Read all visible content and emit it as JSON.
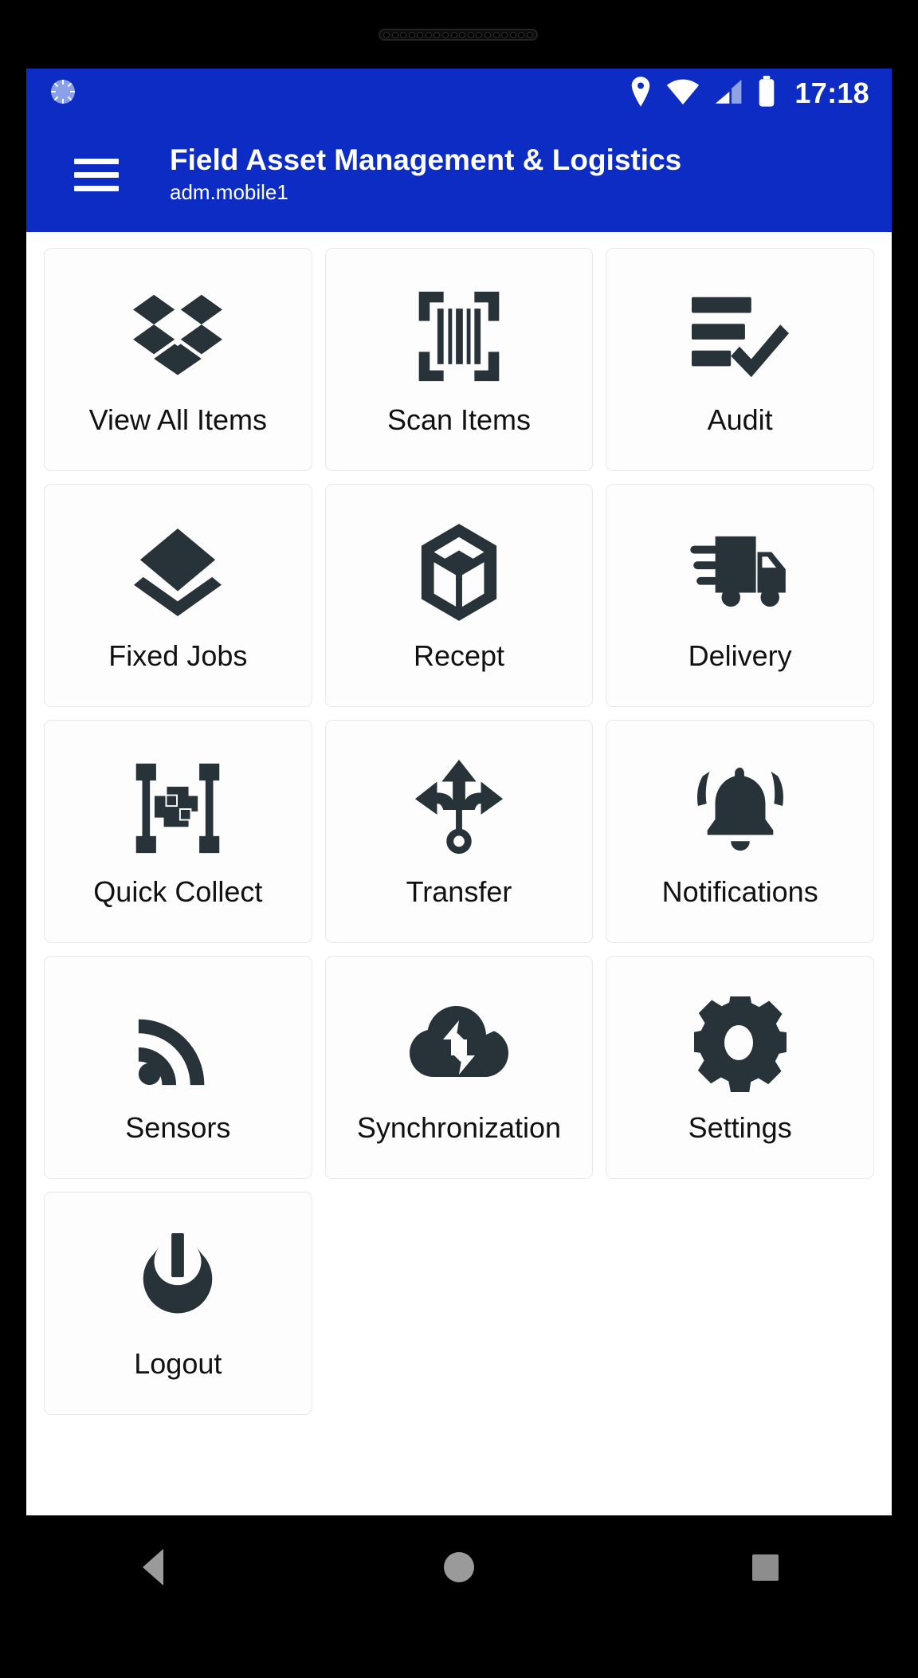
{
  "status_bar": {
    "time": "17:18",
    "left_icons": [
      {
        "name": "sync-spinner-icon",
        "label": "sync in progress"
      }
    ],
    "right_icons": [
      {
        "name": "location-pin-icon",
        "label": "Location"
      },
      {
        "name": "wifi-icon",
        "label": "Wi-Fi"
      },
      {
        "name": "cellular-signal-icon",
        "label": "Cellular signal"
      },
      {
        "name": "battery-icon",
        "label": "Battery full"
      }
    ]
  },
  "app_bar": {
    "menu_icon": "hamburger-menu-icon",
    "title": "Field Asset Management & Logistics",
    "subtitle": "adm.mobile1"
  },
  "theme": {
    "primary": "#0d2cc4",
    "icon": "#273239",
    "tile_background": "#fdfdfd",
    "tile_border": "#e8e8e8",
    "screen_background": "#ffffff",
    "text": "#111111"
  },
  "grid": {
    "tiles": [
      {
        "label": "View All Items",
        "icon": "open-box-icon"
      },
      {
        "label": "Scan Items",
        "icon": "barcode-scan-icon"
      },
      {
        "label": "Audit",
        "icon": "checklist-check-icon"
      },
      {
        "label": "Fixed Jobs",
        "icon": "layers-icon"
      },
      {
        "label": "Recept",
        "icon": "box-open-3d-icon"
      },
      {
        "label": "Delivery",
        "icon": "delivery-truck-icon"
      },
      {
        "label": "Quick Collect",
        "icon": "qr-frame-icon"
      },
      {
        "label": "Transfer",
        "icon": "transfer-arrows-icon"
      },
      {
        "label": "Notifications",
        "icon": "bell-ringing-icon"
      },
      {
        "label": "Sensors",
        "icon": "rss-signal-icon"
      },
      {
        "label": "Synchronization",
        "icon": "cloud-sync-icon"
      },
      {
        "label": "Settings",
        "icon": "gear-icon"
      },
      {
        "label": "Logout",
        "icon": "power-icon"
      }
    ]
  },
  "nav_bar": {
    "buttons": [
      {
        "name": "back-button",
        "label": "Back"
      },
      {
        "name": "home-button",
        "label": "Home"
      },
      {
        "name": "recents-button",
        "label": "Recent apps"
      }
    ]
  }
}
